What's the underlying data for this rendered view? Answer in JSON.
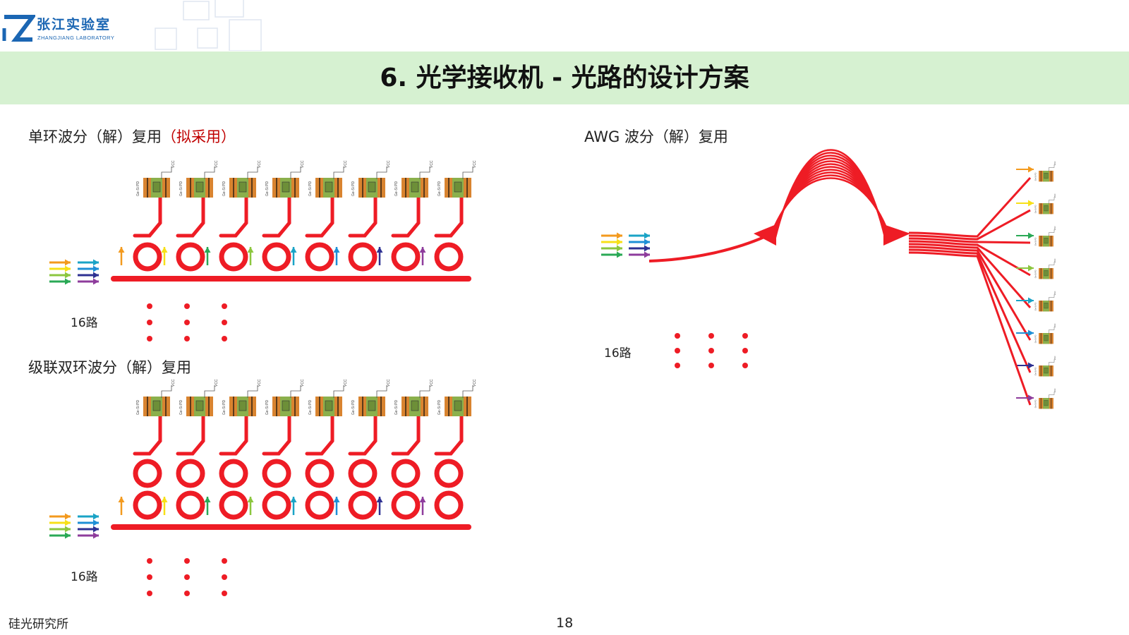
{
  "header": {
    "logo_cn": "张江实验室",
    "logo_en": "ZHANGJIANG   LABORATORY",
    "title": "6. 光学接收机 - 光路的设计方案"
  },
  "left": {
    "section1_label": "单环波分（解）复用",
    "section1_note": "（拟采用）",
    "section1_channels": "16路",
    "section2_label": "级联双环波分（解）复用",
    "section2_channels": "16路"
  },
  "right": {
    "section_label": "AWG 波分（解）复用",
    "channels": "16路"
  },
  "detector": {
    "pd_label": "Ge-Si PD",
    "vcc_label": "VCC"
  },
  "colors": {
    "waveguide": "#ee1c25",
    "detector_orange": "#d98430",
    "detector_green": "#8bb04c",
    "wavelengths": [
      "#f39a1e",
      "#f7e018",
      "#2aa956",
      "#8cc63f",
      "#1aa3c6",
      "#1e8fd6",
      "#2e3192",
      "#8e3c9c"
    ]
  },
  "footer": {
    "org": "硅光研究所",
    "page": "18"
  }
}
